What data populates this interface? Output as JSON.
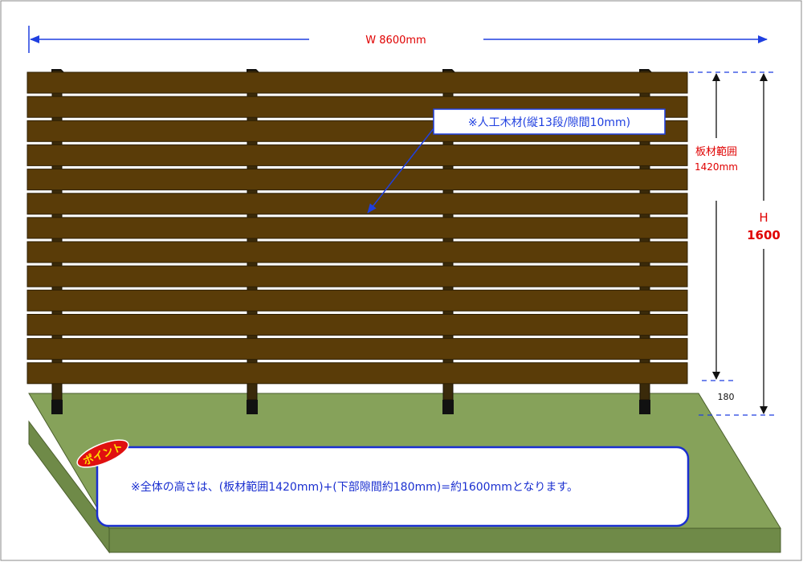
{
  "colors": {
    "plank": "#5a3c08",
    "plank_edge": "#2e1f04",
    "post": "#3a2a0a",
    "ground_top": "#86a25a",
    "ground_side": "#6f8a48",
    "dimension_red": "#e00000",
    "arrow_blue": "#1f3fe0",
    "dash_blue": "#1f3fe0",
    "callout_border": "#1a2fd0",
    "badge_red": "#e01010",
    "badge_yellow": "#ffe000"
  },
  "dimensions": {
    "width_label": "W 8600mm",
    "board_range_label": "板材範囲",
    "board_range_value": "1420mm",
    "height_label_line1": "H",
    "height_label_line2": "1600",
    "bottom_gap_value": "180"
  },
  "material_note": "※人工木材(縦13段/隙間10mm)",
  "point_badge": "ポイント",
  "point_note": "※全体の高さは、(板材範囲1420mm)+(下部隙間約180mm)=約1600mmとなります。",
  "fence": {
    "board_rows": 13,
    "post_count": 4
  }
}
